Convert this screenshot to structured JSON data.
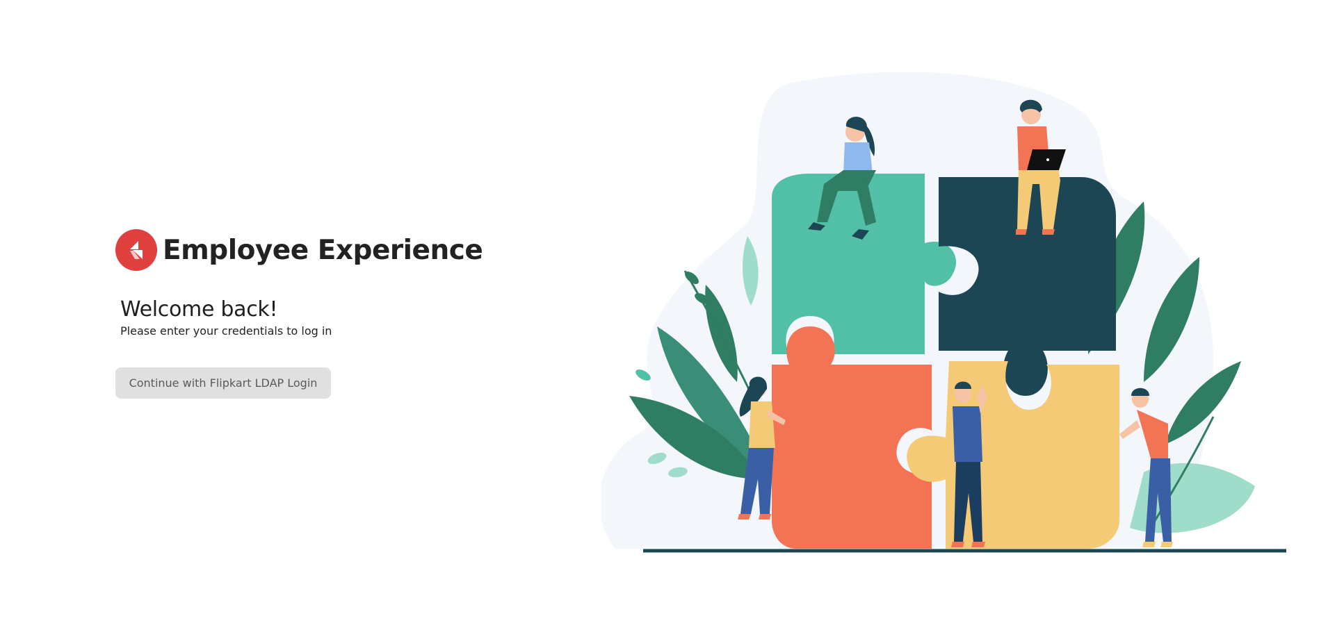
{
  "brand": {
    "title": "Employee Experience",
    "logo_icon": "flipkart-logo-icon",
    "logo_color": "#e0413f"
  },
  "welcome": {
    "heading": "Welcome back!",
    "subtext": "Please enter your credentials to log in"
  },
  "login": {
    "button_label": "Continue with Flipkart LDAP Login"
  },
  "illustration": {
    "icon": "team-puzzle-illustration",
    "colors": {
      "teal": "#52bfa7",
      "dark_teal": "#1c4654",
      "coral": "#f27455",
      "yellow": "#f5ca77",
      "leaf_green": "#2f7d63",
      "blob": "#f3f6fa"
    }
  }
}
